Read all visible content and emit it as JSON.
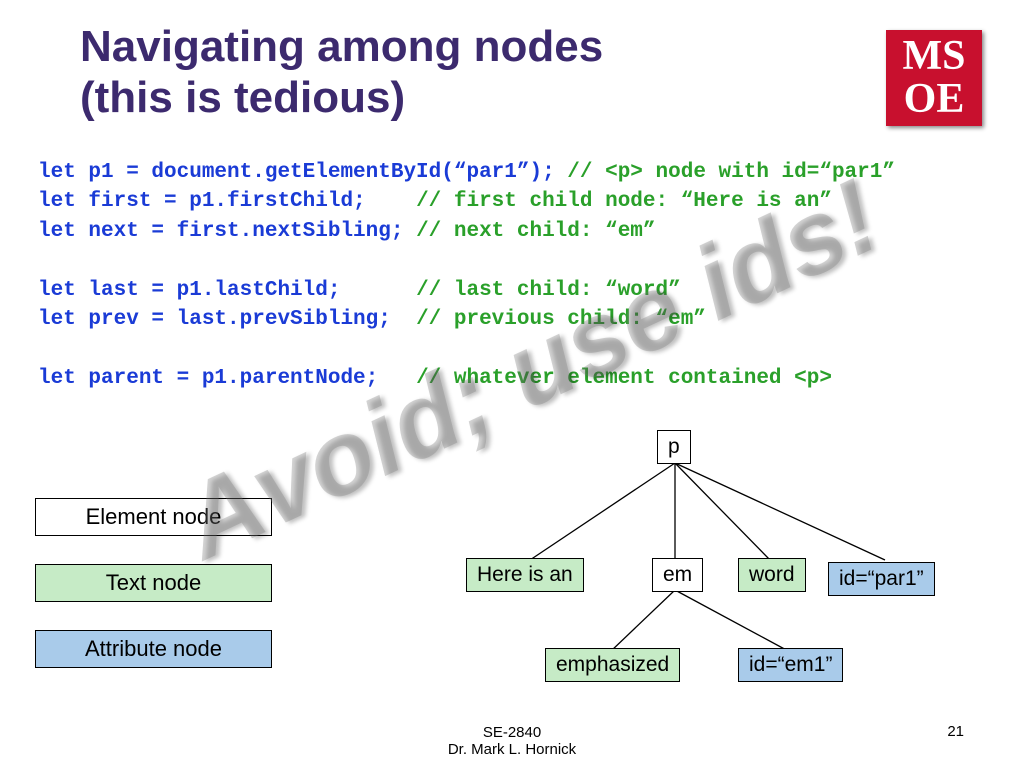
{
  "title_line1": "Navigating among nodes",
  "title_line2": "(this is tedious)",
  "logo": {
    "top": "MS",
    "bottom": "OE"
  },
  "code": {
    "l1a": "let p1 = document.getElementById(“par1”); ",
    "l1b": "// <p> node with id=“par1”",
    "l2a": "let first = p1.firstChild;    ",
    "l2b": "// first child node: “Here is an”",
    "l3a": "let next = first.nextSibling; ",
    "l3b": "// next child: “em”",
    "blank1": "",
    "l4a": "let last = p1.lastChild;      ",
    "l4b": "// last child: “word”",
    "l5a": "let prev = last.prevSibling;  ",
    "l5b": "// previous child: “em”",
    "blank2": "",
    "l6a": "let parent = p1.parentNode;   ",
    "l6b": "// whatever element contained <p>"
  },
  "legend": {
    "element": "Element node",
    "text": "Text node",
    "attribute": "Attribute node"
  },
  "tree": {
    "p": "p",
    "here": "Here is an",
    "em": "em",
    "word": "word",
    "idpar": "id=“par1”",
    "emph": "emphasized",
    "idem": "id=“em1”"
  },
  "watermark": "Avoid; use ids!",
  "footer": {
    "course": "SE-2840",
    "author": "Dr. Mark L. Hornick",
    "page": "21"
  }
}
